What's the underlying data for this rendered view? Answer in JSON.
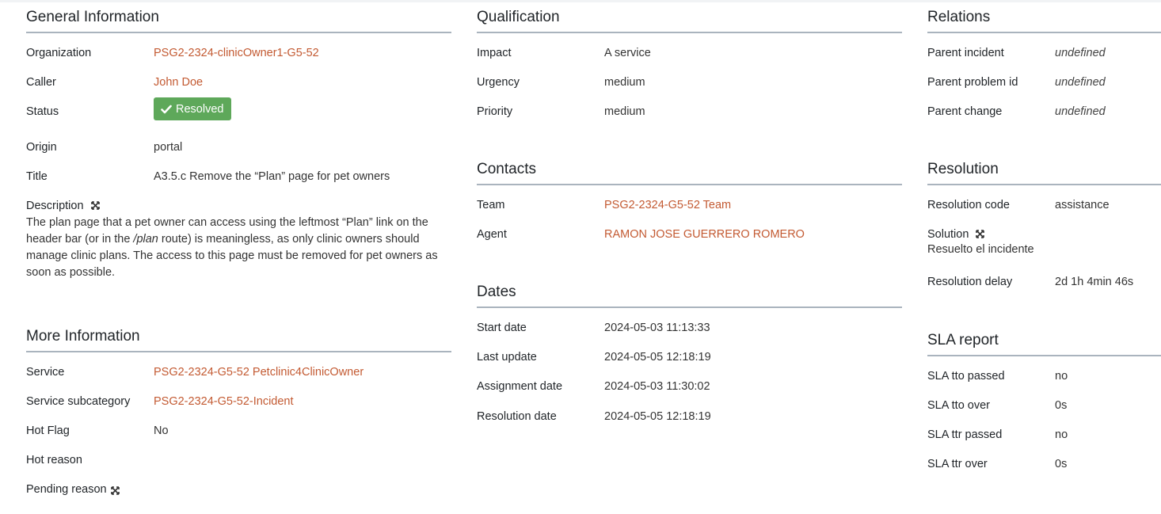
{
  "general": {
    "title": "General Information",
    "organization_label": "Organization",
    "organization_value": "PSG2-2324-clinicOwner1-G5-52",
    "caller_label": "Caller",
    "caller_value": "John Doe",
    "status_label": "Status",
    "status_value": "Resolved",
    "origin_label": "Origin",
    "origin_value": "portal",
    "title_label": "Title",
    "title_value": "A3.5.c Remove the “Plan” page for pet owners",
    "description_label": "Description",
    "description_part1": "The plan page that a pet owner can access using the leftmost “Plan” link on the header bar (or in the ",
    "description_route": "/plan",
    "description_part2": " route) is meaningless, as only clinic owners should manage clinic plans. The access to this page must be removed for pet owners as soon as possible."
  },
  "more": {
    "title": "More Information",
    "service_label": "Service",
    "service_value": "PSG2-2324-G5-52 Petclinic4ClinicOwner",
    "subcategory_label": "Service subcategory",
    "subcategory_value": "PSG2-2324-G5-52-Incident",
    "hotflag_label": "Hot Flag",
    "hotflag_value": "No",
    "hotreason_label": "Hot reason",
    "pending_label": "Pending reason"
  },
  "qualification": {
    "title": "Qualification",
    "impact_label": "Impact",
    "impact_value": "A service",
    "urgency_label": "Urgency",
    "urgency_value": "medium",
    "priority_label": "Priority",
    "priority_value": "medium"
  },
  "contacts": {
    "title": "Contacts",
    "team_label": "Team",
    "team_value": "PSG2-2324-G5-52 Team",
    "agent_label": "Agent",
    "agent_value": "RAMON JOSE GUERRERO ROMERO"
  },
  "dates": {
    "title": "Dates",
    "start_label": "Start date",
    "start_value": "2024-05-03 11:13:33",
    "update_label": "Last update",
    "update_value": "2024-05-05 12:18:19",
    "assignment_label": "Assignment date",
    "assignment_value": "2024-05-03 11:30:02",
    "resolution_label": "Resolution date",
    "resolution_value": "2024-05-05 12:18:19"
  },
  "relations": {
    "title": "Relations",
    "parent_incident_label": "Parent incident",
    "parent_incident_value": "undefined",
    "parent_problem_label": "Parent problem id",
    "parent_problem_value": "undefined",
    "parent_change_label": "Parent change",
    "parent_change_value": "undefined"
  },
  "resolution": {
    "title": "Resolution",
    "code_label": "Resolution code",
    "code_value": "assistance",
    "solution_label": "Solution",
    "solution_value": "Resuelto el incidente",
    "delay_label": "Resolution delay",
    "delay_value": "2d 1h 4min 46s"
  },
  "sla": {
    "title": "SLA report",
    "tto_passed_label": "SLA tto passed",
    "tto_passed_value": "no",
    "tto_over_label": "SLA tto over",
    "tto_over_value": "0s",
    "ttr_passed_label": "SLA ttr passed",
    "ttr_passed_value": "no",
    "ttr_over_label": "SLA ttr over",
    "ttr_over_value": "0s"
  },
  "icons": {
    "status": "check-icon",
    "expand": "expand-icon"
  },
  "colors": {
    "link": "#c35a32",
    "badge": "#5ea85a",
    "divider": "#aab4be"
  }
}
